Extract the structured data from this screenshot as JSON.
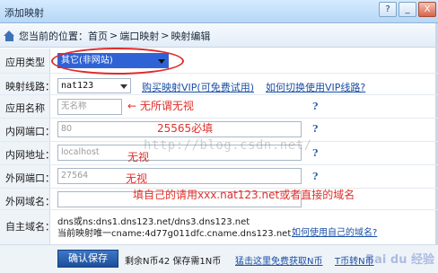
{
  "window": {
    "title": "添加映射",
    "btn_help": "?",
    "btn_min": "_",
    "btn_close": "X"
  },
  "breadcrumb": {
    "prefix": "您当前的位置：",
    "items": [
      "首页",
      "端口映射",
      "映射编辑"
    ],
    "sep": ">"
  },
  "form": {
    "app_type": {
      "label": "应用类型",
      "value": "其它(非网站)"
    },
    "line": {
      "label": "映射线路：",
      "value": "nat123",
      "link1": "购买映射VIP(可免费试用)",
      "link2": "如何切换使用VIP线路?"
    },
    "app_name": {
      "label": "应用名称",
      "placeholder": "无名称"
    },
    "internal_port": {
      "label": "内网端口：",
      "value": "80"
    },
    "internal_addr": {
      "label": "内网地址：",
      "value": "localhost"
    },
    "external_port": {
      "label": "外网端口：",
      "value": "27564"
    },
    "external_domain": {
      "label": "外网域名：",
      "value": ""
    },
    "custom_domain": {
      "label": "自主域名：",
      "dns_line": "dns或ns:dns1.dns123.net/dns3.dns123.net",
      "cname_line": "当前映射唯一cname:4d77g011dfc.cname.dns123.net",
      "link": "如何使用自己的域名?"
    },
    "help_mark": "?"
  },
  "annotations": {
    "app_name": "无所谓无视",
    "internal_port": "25565必填",
    "internal_addr": "无视",
    "external_port": "无视",
    "external_domain": "填自己的请用xxx.nat123.net或者直接的域名"
  },
  "watermark": "http://blog.csdn.net/",
  "bottom": {
    "save_label": "确认保存",
    "remaining": "剩余N币42 保存需1N币",
    "link1": "猛击这里免费获取N币",
    "link2": "T币转N币"
  },
  "corner_mark": "Bai du 经验"
}
